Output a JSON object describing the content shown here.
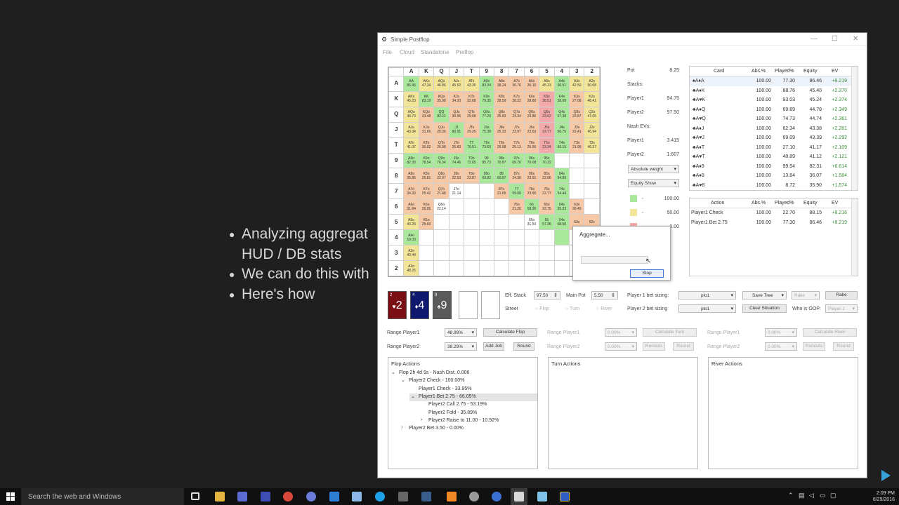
{
  "slide": {
    "bullets": [
      "Analyzing aggregat",
      "HUD / DB stats",
      "We can do this with",
      "Here's how"
    ]
  },
  "window": {
    "title": "Simple Postflop",
    "minimize": "—",
    "maximize": "☐",
    "close": "✕",
    "menu": [
      "File",
      "Cloud",
      "Standalone",
      "Preflop"
    ]
  },
  "grid": {
    "ranks": [
      "A",
      "K",
      "Q",
      "J",
      "T",
      "9",
      "8",
      "7",
      "6",
      "5",
      "4",
      "3",
      "2"
    ],
    "rows": [
      [
        [
          "AA",
          "86.45",
          "g"
        ],
        [
          "AKs",
          "47.34",
          "y"
        ],
        [
          "AQs",
          "46.86",
          "y"
        ],
        [
          "AJs",
          "45.52",
          "y"
        ],
        [
          "ATs",
          "43.30",
          "y"
        ],
        [
          "A9s",
          "83.04",
          "g"
        ],
        [
          "A8s",
          "38.24",
          "o"
        ],
        [
          "A7s",
          "36.76",
          "o"
        ],
        [
          "A6s",
          "36.10",
          "o"
        ],
        [
          "A5s",
          "45.23",
          "y"
        ],
        [
          "A4s",
          "60.51",
          "g"
        ],
        [
          "A3s",
          "42.50",
          "y"
        ],
        [
          "A2s",
          "50.08",
          "y"
        ]
      ],
      [
        [
          "AKo",
          "45.23",
          "y"
        ],
        [
          "KK",
          "83.19",
          "g"
        ],
        [
          "KQs",
          "35.98",
          "o"
        ],
        [
          "KJs",
          "34.20",
          "o"
        ],
        [
          "KTs",
          "32.68",
          "o"
        ],
        [
          "K9s",
          "79.35",
          "g"
        ],
        [
          "K8s",
          "28.59",
          "o"
        ],
        [
          "K7s",
          "28.22",
          "o"
        ],
        [
          "K6s",
          "28.80",
          "o"
        ],
        [
          "K5s",
          "28.51",
          "r"
        ],
        [
          "K4s",
          "58.08",
          "g"
        ],
        [
          "K3s",
          "27.08",
          "o"
        ],
        [
          "K2s",
          "48.41",
          "y"
        ]
      ],
      [
        [
          "AQo",
          "44.73",
          "y"
        ],
        [
          "KQo",
          "33.48",
          "o"
        ],
        [
          "QQ",
          "82.11",
          "g"
        ],
        [
          "QJs",
          "30.96",
          "o"
        ],
        [
          "QTs",
          "29.68",
          "o"
        ],
        [
          "Q9s",
          "77.20",
          "g"
        ],
        [
          "Q8s",
          "25.83",
          "o"
        ],
        [
          "Q7s",
          "24.34",
          "o"
        ],
        [
          "Q6s",
          "23.86",
          "o"
        ],
        [
          "Q5s",
          "23.62",
          "r"
        ],
        [
          "Q4s",
          "57.38",
          "g"
        ],
        [
          "Q3s",
          "23.87",
          "o"
        ],
        [
          "Q2s",
          "47.65",
          "y"
        ]
      ],
      [
        [
          "AJo",
          "43.34",
          "y"
        ],
        [
          "KJo",
          "31.65",
          "o"
        ],
        [
          "QJo",
          "28.36",
          "o"
        ],
        [
          "JJ",
          "80.91",
          "g"
        ],
        [
          "JTs",
          "29.25",
          "o"
        ],
        [
          "J9s",
          "75.38",
          "g"
        ],
        [
          "J8s",
          "25.33",
          "o"
        ],
        [
          "J7s",
          "23.97",
          "o"
        ],
        [
          "J6s",
          "23.63",
          "o"
        ],
        [
          "J5s",
          "23.77",
          "r"
        ],
        [
          "J4s",
          "56.75",
          "g"
        ],
        [
          "J3s",
          "22.41",
          "o"
        ],
        [
          "J2s",
          "46.94",
          "y"
        ]
      ],
      [
        [
          "ATo",
          "41.07",
          "y"
        ],
        [
          "KTo",
          "30.02",
          "o"
        ],
        [
          "QTo",
          "26.98",
          "o"
        ],
        [
          "JTo",
          "26.60",
          "o"
        ],
        [
          "TT",
          "79.51",
          "g"
        ],
        [
          "T9s",
          "73.60",
          "g"
        ],
        [
          "T8s",
          "26.58",
          "o"
        ],
        [
          "T7s",
          "25.13",
          "o"
        ],
        [
          "T6s",
          "25.56",
          "o"
        ],
        [
          "T5s",
          "23.34",
          "r"
        ],
        [
          "T4s",
          "56.15",
          "g"
        ],
        [
          "T3s",
          "21.99",
          "o"
        ],
        [
          "T2s",
          "46.37",
          "y"
        ]
      ],
      [
        [
          "A9o",
          "82.33",
          "g"
        ],
        [
          "K9o",
          "78.54",
          "g"
        ],
        [
          "Q9o",
          "76.34",
          "g"
        ],
        [
          "J9o",
          "74.46",
          "g"
        ],
        [
          "T9o",
          "72.65",
          "g"
        ],
        [
          "99",
          "95.73",
          "g"
        ],
        [
          "98s",
          "70.87",
          "g"
        ],
        [
          "97s",
          "69.76",
          "g"
        ],
        [
          "96s",
          "70.08",
          "g"
        ],
        [
          "95s",
          "70.22",
          "g"
        ],
        [
          "",
          "",
          "w"
        ],
        [
          "",
          "",
          "w"
        ],
        [
          "",
          "",
          "w"
        ]
      ],
      [
        [
          "A8o",
          "35.86",
          "o"
        ],
        [
          "K8o",
          "25.81",
          "o"
        ],
        [
          "Q8o",
          "22.97",
          "o"
        ],
        [
          "J8o",
          "22.53",
          "o"
        ],
        [
          "T8o",
          "23.87",
          "o"
        ],
        [
          "98o",
          "69.82",
          "g"
        ],
        [
          "88",
          "60.87",
          "g"
        ],
        [
          "87s",
          "24.38",
          "o"
        ],
        [
          "86s",
          "23.91",
          "o"
        ],
        [
          "85s",
          "22.66",
          "o"
        ],
        [
          "84s",
          "54.89",
          "g"
        ],
        [
          "",
          "",
          "w"
        ],
        [
          "",
          "",
          "w"
        ]
      ],
      [
        [
          "A7o",
          "34.30",
          "o"
        ],
        [
          "K7o",
          "25.42",
          "o"
        ],
        [
          "Q7o",
          "21.48",
          "o"
        ],
        [
          "J7o",
          "21.14",
          "w"
        ],
        [
          "",
          "",
          "w"
        ],
        [
          "",
          "",
          "w"
        ],
        [
          "87o",
          "21.65",
          "o"
        ],
        [
          "77",
          "59.08",
          "g"
        ],
        [
          "76s",
          "23.90",
          "o"
        ],
        [
          "75s",
          "22.77",
          "o"
        ],
        [
          "74s",
          "54.44",
          "g"
        ],
        [
          "",
          "",
          "w"
        ],
        [
          "",
          "",
          "w"
        ]
      ],
      [
        [
          "A6o",
          "31.64",
          "o"
        ],
        [
          "K6o",
          "26.05",
          "o"
        ],
        [
          "Q6o",
          "22.14",
          "w"
        ],
        [
          "",
          "",
          "w"
        ],
        [
          "",
          "",
          "w"
        ],
        [
          "",
          "",
          "w"
        ],
        [
          "",
          "",
          "w"
        ],
        [
          "76o",
          "21.20",
          "o"
        ],
        [
          "66",
          "58.35",
          "g"
        ],
        [
          "65s",
          "33.75",
          "o"
        ],
        [
          "64s",
          "55.23",
          "g"
        ],
        [
          "63s",
          "30.43",
          "o"
        ],
        [
          "",
          "",
          "w"
        ]
      ],
      [
        [
          "A5o",
          "43.23",
          "y"
        ],
        [
          "K5o",
          "25.93",
          "o"
        ],
        [
          "",
          "",
          "w"
        ],
        [
          "",
          "",
          "w"
        ],
        [
          "",
          "",
          "w"
        ],
        [
          "",
          "",
          "w"
        ],
        [
          "",
          "",
          "w"
        ],
        [
          "",
          "",
          "w"
        ],
        [
          "65o",
          "31.54",
          "w"
        ],
        [
          "55",
          "57.36",
          "g"
        ],
        [
          "54s",
          "58.50",
          "g"
        ],
        [
          "53s",
          "",
          "o"
        ],
        [
          "52s",
          "",
          "o"
        ]
      ],
      [
        [
          "A4o",
          "59.03",
          "g"
        ],
        [
          "",
          "",
          "w"
        ],
        [
          "",
          "",
          "w"
        ],
        [
          "",
          "",
          "w"
        ],
        [
          "",
          "",
          "w"
        ],
        [
          "",
          "",
          "w"
        ],
        [
          "",
          "",
          "w"
        ],
        [
          "",
          "",
          "w"
        ],
        [
          "",
          "",
          "w"
        ],
        [
          "",
          "",
          "w"
        ],
        [
          "",
          "",
          "g"
        ],
        [
          "",
          "",
          "w"
        ],
        [
          "",
          "",
          "w"
        ]
      ],
      [
        [
          "A3o",
          "40.44",
          "y"
        ],
        [
          "",
          "",
          "w"
        ],
        [
          "",
          "",
          "w"
        ],
        [
          "",
          "",
          "w"
        ],
        [
          "",
          "",
          "w"
        ],
        [
          "",
          "",
          "w"
        ],
        [
          "",
          "",
          "w"
        ],
        [
          "",
          "",
          "w"
        ],
        [
          "",
          "",
          "w"
        ],
        [
          "",
          "",
          "w"
        ],
        [
          "",
          "",
          "w"
        ],
        [
          "",
          "",
          "w"
        ],
        [
          "",
          "",
          "w"
        ]
      ],
      [
        [
          "A2o",
          "48.25",
          "y"
        ],
        [
          "",
          "",
          "w"
        ],
        [
          "",
          "",
          "w"
        ],
        [
          "",
          "",
          "w"
        ],
        [
          "",
          "",
          "w"
        ],
        [
          "",
          "",
          "w"
        ],
        [
          "",
          "",
          "w"
        ],
        [
          "",
          "",
          "w"
        ],
        [
          "",
          "",
          "w"
        ],
        [
          "",
          "",
          "w"
        ],
        [
          "",
          "",
          "w"
        ],
        [
          "",
          "",
          "w"
        ],
        [
          "",
          "",
          "w"
        ]
      ]
    ]
  },
  "stats": {
    "pot_label": "Pot",
    "pot_value": "8.25",
    "stacks_label": "Stacks:",
    "p1_label": "Player1",
    "p1_value": "94.75",
    "p2_label": "Player2",
    "p2_value": "97.50",
    "nash_label": "Nash EVs:",
    "nash_p1_label": "Player1",
    "nash_p1_value": "3.415",
    "nash_p2_label": "Player2",
    "nash_p2_value": "1.607",
    "weight_select": "Absolute weight",
    "equity_select": "Equity Show",
    "legend": [
      {
        "dash": "-",
        "value": "100.00",
        "color": "#a9e79a"
      },
      {
        "dash": "-",
        "value": "50.00",
        "color": "#f3e598"
      },
      {
        "dash": "",
        "value": "0.00",
        "color": "#f3a9a9"
      }
    ]
  },
  "card_table": {
    "headers": [
      "Card",
      "Abs.%",
      "Played%",
      "Equity",
      "EV"
    ],
    "rows": [
      [
        "♠A♦A",
        "100.00",
        "77.30",
        "86.46",
        "+8.219"
      ],
      [
        "♣A♦K",
        "100.00",
        "88.76",
        "45.40",
        "+2.370"
      ],
      [
        "♣A♥K",
        "100.00",
        "93.03",
        "45.24",
        "+2.374"
      ],
      [
        "♣A♦Q",
        "100.00",
        "69.89",
        "44.78",
        "+2.349"
      ],
      [
        "♣A♥Q",
        "100.00",
        "74.73",
        "44.74",
        "+2.361"
      ],
      [
        "♣A♦J",
        "100.00",
        "62.34",
        "43.38",
        "+2.281"
      ],
      [
        "♣A♥J",
        "100.00",
        "69.09",
        "43.39",
        "+2.292"
      ],
      [
        "♣A♦T",
        "100.00",
        "27.10",
        "41.17",
        "+2.109"
      ],
      [
        "♣A♥T",
        "100.00",
        "40.89",
        "41.12",
        "+2.121"
      ],
      [
        "♣A♦9",
        "100.00",
        "99.54",
        "82.31",
        "+6.614"
      ],
      [
        "♣A♦8",
        "100.00",
        "13.84",
        "36.07",
        "+1.584"
      ],
      [
        "♣A♥8",
        "100.00",
        "8.72",
        "35.90",
        "+1.574"
      ]
    ]
  },
  "action_table": {
    "headers": [
      "Action",
      "Abs.%",
      "Played%",
      "Equity",
      "EV"
    ],
    "rows": [
      [
        "Player1 Check",
        "100.00",
        "22.70",
        "88.15",
        "+8.216"
      ],
      [
        "Player1 Bet 2.75",
        "100.00",
        "77.30",
        "86.46",
        "+8.219"
      ]
    ]
  },
  "board": {
    "cards": [
      {
        "rank": "2",
        "corner": "2",
        "suit": "♥",
        "color": "#7a0f14"
      },
      {
        "rank": "4",
        "corner": "4",
        "suit": "♦",
        "color": "#0f1a6e"
      },
      {
        "rank": "9",
        "corner": "9",
        "suit": "♠",
        "color": "#5a5a5a"
      }
    ]
  },
  "controls": {
    "eff_stack_label": "Eff. Stack",
    "eff_stack_value": "97.50",
    "main_pot_label": "Main Pot",
    "main_pot_value": "5.50",
    "street_label": "Street",
    "street_flop": "Flop",
    "street_turn": "Turn",
    "street_river": "River",
    "p1_bet_sizing_label": "Player 1 bet sizing:",
    "p1_bet_sizing_value": "plo1",
    "p2_bet_sizing_label": "Player 2 bet sizing",
    "p2_bet_sizing_value": "plo1",
    "save_tree": "Save Tree",
    "rake_select": "Rake",
    "rake_button": "Rake",
    "clear_situation": "Clear Situation",
    "who_oop_label": "Who is OOP:",
    "who_oop_value": "Player 2",
    "range_p1_label": "Range Player1",
    "range_p1_value": "48.99%",
    "range_p2_label": "Range Player2",
    "range_p2_value": "38.29%",
    "calc_flop": "Calculate Flop",
    "add_job": "Add Job",
    "round": "Round",
    "turn_range_p1_label": "Range Player1",
    "turn_range_p1_value": "0.00%",
    "turn_range_p2_label": "Range Player2",
    "turn_range_p2_value": "0.00%",
    "calc_turn": "Calculate Turn",
    "turn_runouts": "Runouts",
    "turn_round": "Round",
    "river_range_p1_label": "Range Player1",
    "river_range_p1_value": "0.00%",
    "river_range_p2_label": "Range Player2",
    "river_range_p2_value": "0.00%",
    "calc_river": "Calculate River",
    "river_runouts": "Runouts",
    "river_round": "Round"
  },
  "flop_actions": {
    "title": "Flop Actions",
    "nodes": [
      {
        "text": "Flop 2h 4d 9s - Nash Dist. 0.006",
        "indent": 0,
        "arrow": "⌄"
      },
      {
        "text": "Player2 Check - 100.00%",
        "indent": 1,
        "arrow": "⌄"
      },
      {
        "text": "Player1 Check - 33.95%",
        "indent": 2,
        "arrow": ""
      },
      {
        "text": "Player1 Bet 2.75 - 66.05%",
        "indent": 2,
        "arrow": "⌄",
        "selected": true
      },
      {
        "text": "Player2 Call 2.75 - 53.19%",
        "indent": 3,
        "arrow": ""
      },
      {
        "text": "Player2 Fold - 35.89%",
        "indent": 3,
        "arrow": ""
      },
      {
        "text": "Player2 Raise to 11.00 - 10.92%",
        "indent": 3,
        "arrow": "›"
      },
      {
        "text": "Player2 Bet 3.50 - 0.00%",
        "indent": 1,
        "arrow": "›"
      }
    ]
  },
  "turn_actions": {
    "title": "Turn Actions"
  },
  "river_actions": {
    "title": "River Actions"
  },
  "dialog": {
    "title": "Aggregate...",
    "stop": "Stop"
  },
  "taskbar": {
    "search_placeholder": "Search the web and Windows",
    "time": "2:09 PM",
    "date": "6/29/2016"
  }
}
